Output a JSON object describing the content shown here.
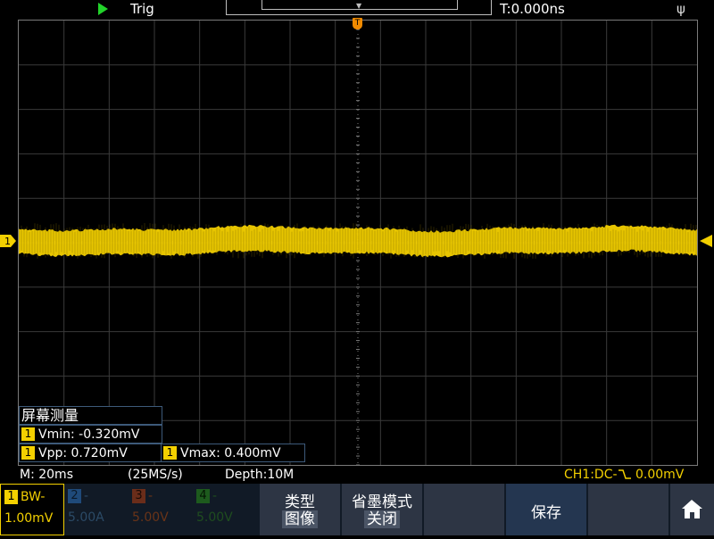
{
  "topbar": {
    "trig_label": "Trig",
    "time_offset": "T:0.000ns",
    "usb_icon": "usb-icon"
  },
  "screen": {
    "trig_pos_marker": "T",
    "ch1_marker": "1"
  },
  "measure": {
    "title": "屏幕测量",
    "vmin": "Vmin: -0.320mV",
    "vpp": "Vpp: 0.720mV",
    "vmax": "Vmax: 0.400mV",
    "badge": "1"
  },
  "status": {
    "timebase": "M: 20ms",
    "samplerate": "(25MS/s)",
    "depth": "Depth:10M",
    "ch1_prefix": "CH1:DC-",
    "ch1_level": "0.00mV"
  },
  "channels": [
    {
      "num": "1",
      "label": "BW-",
      "scale": "1.00mV"
    },
    {
      "num": "2",
      "label": "-",
      "scale": "5.00A"
    },
    {
      "num": "3",
      "label": "-",
      "scale": "5.00V"
    },
    {
      "num": "4",
      "label": "-",
      "scale": "5.00V"
    }
  ],
  "softkeys": {
    "type_title": "类型",
    "type_value": "图像",
    "ink_title": "省墨模式",
    "ink_value": "关闭",
    "save": "保存"
  },
  "colors": {
    "ch1": "#f3d000",
    "trigger": "#f08a00",
    "run": "#22d32a"
  }
}
